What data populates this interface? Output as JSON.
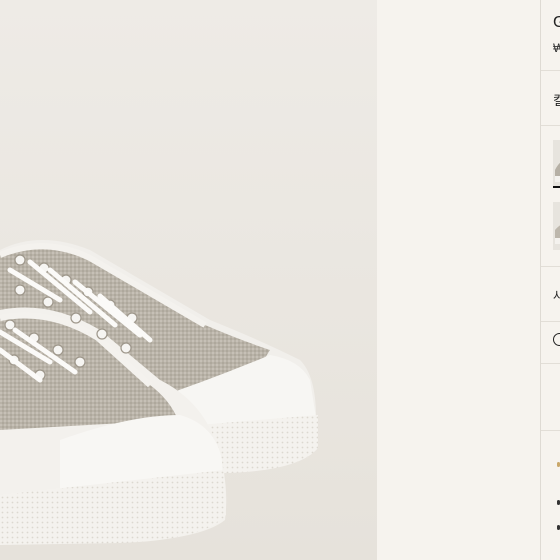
{
  "product": {
    "title_partial": "G",
    "price_partial": "₩",
    "color_label_partial": "컬",
    "size_label_partial": "사",
    "gift_label_partial": "G"
  },
  "gallery": {
    "main_image": "canvas-sneakers-pair",
    "thumbnails": [
      {
        "name": "thumbnail-1",
        "selected": true
      },
      {
        "name": "thumbnail-2",
        "selected": false
      }
    ]
  },
  "colors": {
    "background": "#f6f3ee",
    "image_background": "#ece9e3",
    "divider": "#dedad3",
    "accent": "#111111"
  }
}
